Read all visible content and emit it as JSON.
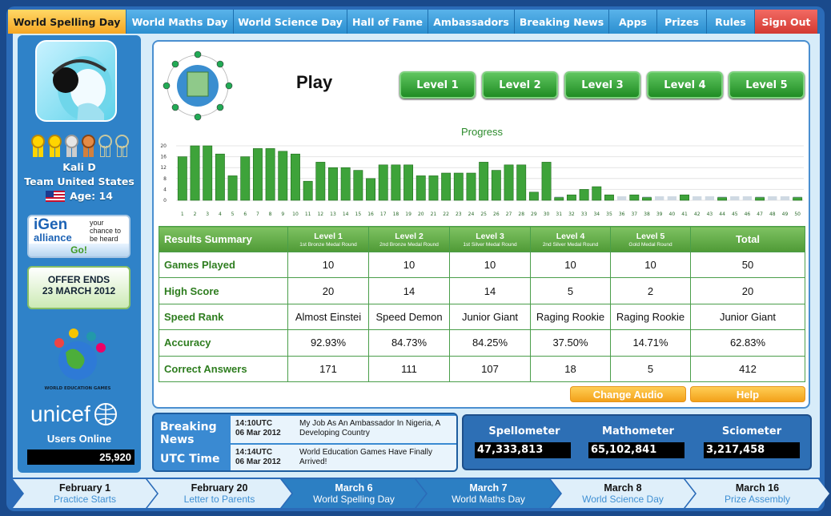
{
  "nav": {
    "tabs": [
      "World Spelling Day",
      "World Maths Day",
      "World Science Day",
      "Hall of Fame",
      "Ambassadors",
      "Breaking News",
      "Apps",
      "Prizes",
      "Rules",
      "Sign Out"
    ]
  },
  "profile": {
    "name": "Kali D",
    "team": "Team United States",
    "age": "Age: 14"
  },
  "igen": {
    "brand_top": "iGen",
    "brand_bottom": "alliance",
    "tagline_1": "your",
    "tagline_2": "chance to",
    "tagline_3": "be heard",
    "go": "Go!"
  },
  "offer": {
    "line1": "OFFER ENDS",
    "line2": "23 MARCH 2012"
  },
  "weg_logo_text": "WORLD EDUCATION GAMES",
  "unicef": "unicef",
  "users": {
    "label": "Users Online",
    "count": "25,920"
  },
  "play": {
    "title": "Play",
    "levels": [
      "Level 1",
      "Level 2",
      "Level 3",
      "Level 4",
      "Level 5"
    ]
  },
  "progress": {
    "title": "Progress"
  },
  "chart_data": {
    "type": "bar",
    "categories": [
      "1",
      "2",
      "3",
      "4",
      "5",
      "6",
      "7",
      "8",
      "9",
      "10",
      "11",
      "12",
      "13",
      "14",
      "15",
      "16",
      "17",
      "18",
      "19",
      "20",
      "21",
      "22",
      "23",
      "24",
      "25",
      "26",
      "27",
      "28",
      "29",
      "30",
      "31",
      "32",
      "33",
      "34",
      "35",
      "36",
      "37",
      "38",
      "39",
      "40",
      "41",
      "42",
      "43",
      "44",
      "45",
      "46",
      "47",
      "48",
      "49",
      "50"
    ],
    "values": [
      16,
      20,
      20,
      17,
      9,
      16,
      19,
      19,
      18,
      17,
      7,
      14,
      12,
      12,
      11,
      8,
      13,
      13,
      13,
      9,
      9,
      10,
      10,
      10,
      14,
      11,
      13,
      13,
      3,
      14,
      1,
      2,
      4,
      5,
      2,
      0,
      2,
      1,
      0,
      0,
      2,
      0,
      0,
      1,
      0,
      0,
      1,
      0,
      0,
      1
    ],
    "yticks": [
      "0",
      "4",
      "8",
      "12",
      "16",
      "20"
    ],
    "ylim": [
      0,
      20
    ]
  },
  "results": {
    "header_first": "Results Summary",
    "columns": [
      {
        "main": "Level 1",
        "sub": "1st Bronze Medal Round"
      },
      {
        "main": "Level 2",
        "sub": "2nd Bronze Medal Round"
      },
      {
        "main": "Level 3",
        "sub": "1st Silver Medal Round"
      },
      {
        "main": "Level 4",
        "sub": "2nd Silver Medal Round"
      },
      {
        "main": "Level 5",
        "sub": "Gold Medal Round"
      }
    ],
    "header_total": "Total",
    "rows": [
      {
        "label": "Games Played",
        "cells": [
          "10",
          "10",
          "10",
          "10",
          "10",
          "50"
        ]
      },
      {
        "label": "High Score",
        "cells": [
          "20",
          "14",
          "14",
          "5",
          "2",
          "20"
        ]
      },
      {
        "label": "Speed Rank",
        "cells": [
          "Almost Einstei",
          "Speed Demon",
          "Junior Giant",
          "Raging Rookie",
          "Raging Rookie",
          "Junior Giant"
        ]
      },
      {
        "label": "Accuracy",
        "cells": [
          "92.93%",
          "84.73%",
          "84.25%",
          "37.50%",
          "14.71%",
          "62.83%"
        ]
      },
      {
        "label": "Correct Answers",
        "cells": [
          "171",
          "111",
          "107",
          "18",
          "5",
          "412"
        ]
      }
    ]
  },
  "buttons": {
    "change_audio": "Change Audio",
    "help": "Help"
  },
  "breaking": {
    "label_top": "Breaking",
    "label_bottom": "News",
    "utc_label": "UTC Time",
    "items": [
      {
        "time": "14:10UTC",
        "date": "06 Mar 2012",
        "text": "My Job As An Ambassador In Nigeria, A Developing Country"
      },
      {
        "time": "14:14UTC",
        "date": "06 Mar 2012",
        "text": "World Education Games Have Finally Arrived!"
      }
    ]
  },
  "meters": [
    {
      "label": "Spellometer",
      "value": "47,333,813"
    },
    {
      "label": "Mathometer",
      "value": "65,102,841"
    },
    {
      "label": "Sciometer",
      "value": "3,217,458"
    }
  ],
  "timeline": [
    {
      "date": "February 1",
      "label": "Practice Starts",
      "style": "light"
    },
    {
      "date": "February 20",
      "label": "Letter to Parents",
      "style": "light"
    },
    {
      "date": "March 6",
      "label": "World Spelling Day",
      "style": "dark"
    },
    {
      "date": "March 7",
      "label": "World Maths Day",
      "style": "dark"
    },
    {
      "date": "March 8",
      "label": "World Science Day",
      "style": "light"
    },
    {
      "date": "March 16",
      "label": "Prize Assembly",
      "style": "light"
    }
  ],
  "colors": {
    "accent_orange": "#f5a623",
    "bar_green": "#3ea33a",
    "panel_blue": "#2f82c8"
  }
}
